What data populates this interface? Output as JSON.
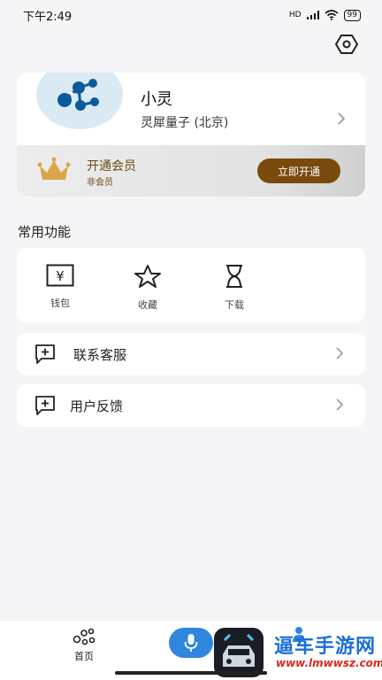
{
  "status_bar": {
    "time": "下午2:49",
    "network": "HD",
    "battery": "99"
  },
  "profile": {
    "name": "小灵",
    "organization": "灵犀量子 (北京)"
  },
  "vip": {
    "title": "开通会员",
    "status": "非会员",
    "button": "立即开通"
  },
  "common_functions": {
    "title": "常用功能",
    "items": [
      {
        "label": "钱包",
        "icon": "wallet-icon"
      },
      {
        "label": "收藏",
        "icon": "star-icon"
      },
      {
        "label": "下载",
        "icon": "hourglass-icon"
      }
    ]
  },
  "menu": {
    "contact_support": "联系客服",
    "feedback": "用户反馈"
  },
  "tab_bar": {
    "home_label": "首页"
  },
  "watermark": {
    "text": "逼车手游网",
    "url": "www.lmwwsz.com"
  },
  "colors": {
    "accent": "#2f86de",
    "vip_button": "#7a4a0d",
    "vip_text": "#6b4a12",
    "brand_dark": "#0a5a9c"
  }
}
